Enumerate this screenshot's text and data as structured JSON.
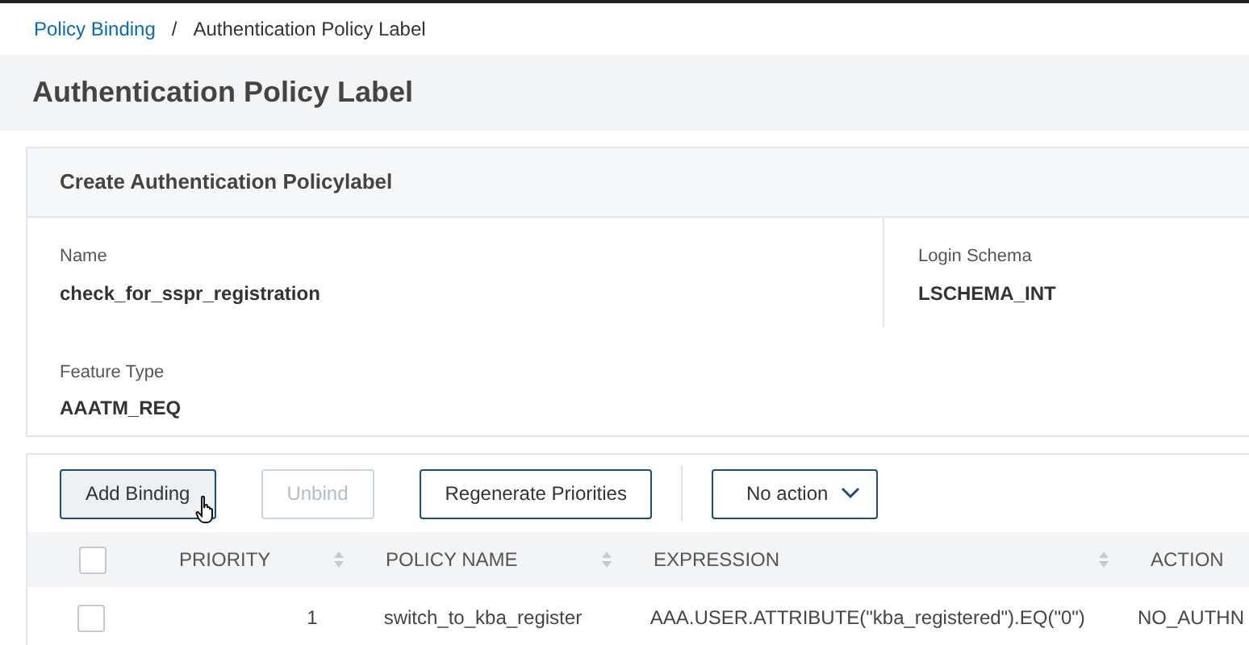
{
  "breadcrumb": {
    "link": "Policy Binding",
    "separator": "/",
    "current": "Authentication Policy Label"
  },
  "page_title": "Authentication Policy Label",
  "card": {
    "title": "Create Authentication Policylabel",
    "fields": [
      {
        "label": "Name",
        "value": "check_for_sspr_registration"
      },
      {
        "label": "Login Schema",
        "value": "LSCHEMA_INT"
      },
      {
        "label": "Feature Type",
        "value": "AAATM_REQ"
      }
    ]
  },
  "toolbar": {
    "buttons": [
      {
        "label": "Add Binding",
        "disabled": false,
        "hovered": true
      },
      {
        "label": "Unbind",
        "disabled": true,
        "hovered": false
      },
      {
        "label": "Regenerate Priorities",
        "disabled": false,
        "hovered": false
      }
    ],
    "action_menu": "No action"
  },
  "table": {
    "select_all_checked": false,
    "columns": [
      {
        "label": "PRIORITY",
        "sortable": true
      },
      {
        "label": "POLICY NAME",
        "sortable": true
      },
      {
        "label": "EXPRESSION",
        "sortable": true
      },
      {
        "label": "ACTION",
        "sortable": false
      }
    ],
    "rows": [
      {
        "checked": false,
        "cells": [
          "1",
          "switch_to_kba_register",
          "AAA.USER.ATTRIBUTE(\"kba_registered\").EQ(\"0\")",
          "NO_AUTHN"
        ]
      }
    ]
  }
}
